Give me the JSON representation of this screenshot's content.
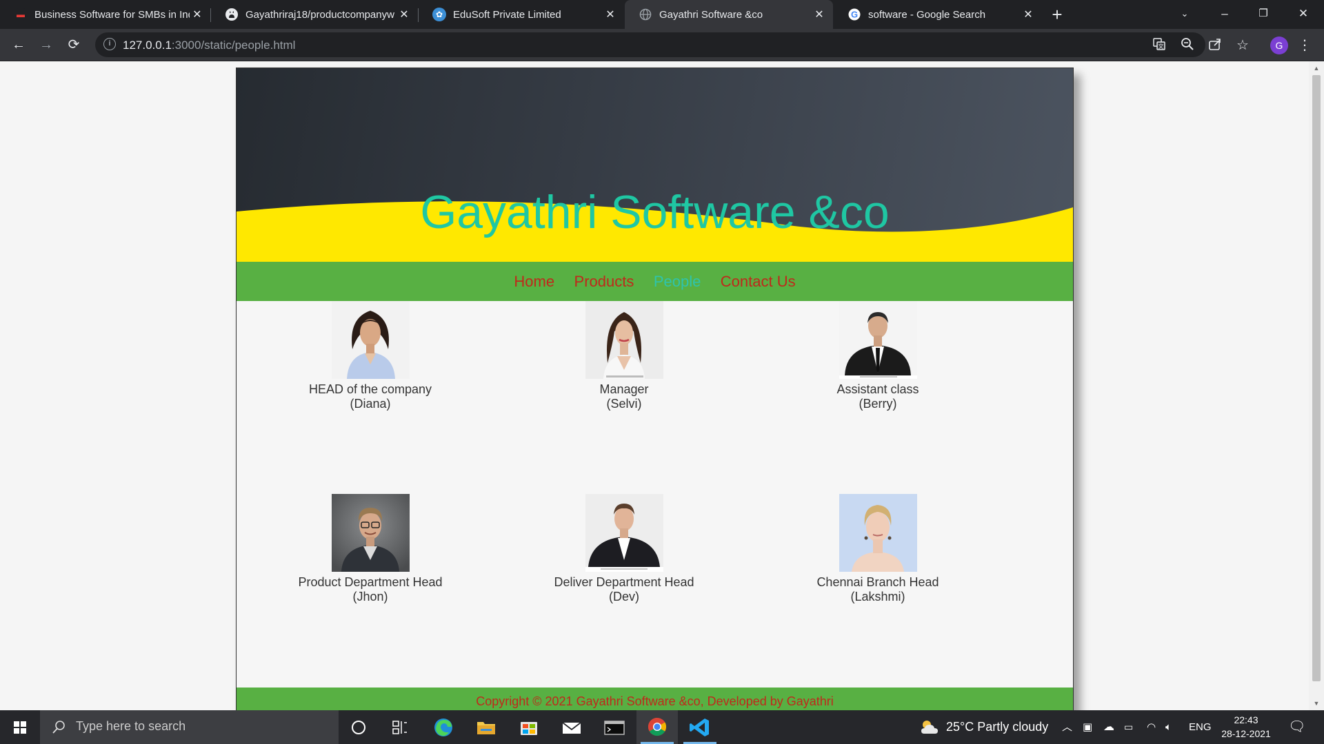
{
  "browser": {
    "tabs": [
      {
        "title": "Business Software for SMBs in India",
        "favicon": "zoho-logo-icon",
        "active": false
      },
      {
        "title": "Gayathriraj18/productcompanyw",
        "favicon": "github-icon",
        "active": false
      },
      {
        "title": "EduSoft Private Limited",
        "favicon": "edusoft-logo-icon",
        "active": false
      },
      {
        "title": "Gayathri Software &co",
        "favicon": "globe-icon",
        "active": true
      },
      {
        "title": "software - Google Search",
        "favicon": "google-icon",
        "active": false
      }
    ],
    "address": {
      "host": "127.0.0.1",
      "rest": ":3000/static/people.html"
    },
    "profile_initial": "G"
  },
  "site": {
    "title": "Gayathri Software &co",
    "nav": [
      {
        "label": "Home",
        "current": false
      },
      {
        "label": "Products",
        "current": false
      },
      {
        "label": "People",
        "current": true
      },
      {
        "label": "Contact Us",
        "current": false
      }
    ],
    "people": [
      {
        "role": "HEAD of the company",
        "name": "(Diana)"
      },
      {
        "role": "Manager",
        "name": "(Selvi)"
      },
      {
        "role": "Assistant class",
        "name": "(Berry)"
      },
      {
        "role": "Product Department Head",
        "name": "(Jhon)"
      },
      {
        "role": "Deliver Department Head",
        "name": "(Dev)"
      },
      {
        "role": "Chennai Branch Head",
        "name": "(Lakshmi)"
      }
    ],
    "footer": "Copyright © 2021 Gayathri Software &co, Developed by Gayathri",
    "colors": {
      "title": "#1fc7a3",
      "nav_bg": "#58b043",
      "link": "#c0281b",
      "current_link": "#2ec4ad",
      "wave": "#ffe800"
    }
  },
  "taskbar": {
    "search_placeholder": "Type here to search",
    "weather": "25°C  Partly cloudy",
    "language": "ENG",
    "time": "22:43",
    "date": "28-12-2021"
  }
}
